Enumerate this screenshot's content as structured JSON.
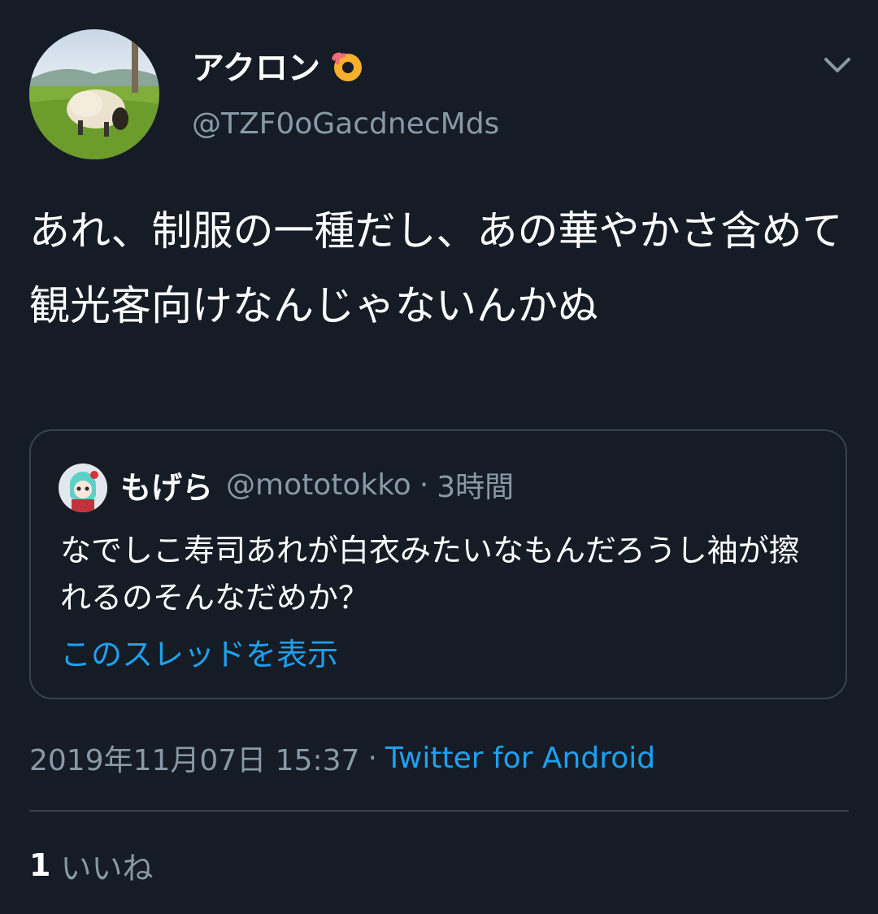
{
  "author": {
    "display_name": "アクロン",
    "emoji_icon": "ok-hand-emoji-icon",
    "handle": "@TZF0oGacdnecMds",
    "avatar_icon": "sheep-photo-avatar"
  },
  "tweet": {
    "text": "あれ、制服の一種だし、あの華やかさ含めて観光客向けなんじゃないんかぬ"
  },
  "quote": {
    "author_name": "もげら",
    "author_handle": "@mototokko",
    "separator": "·",
    "time": "3時間",
    "text": "なでしこ寿司あれが白衣みたいなもんだろうし袖が擦れるのそんなだめか？",
    "link_label": "このスレッドを表示",
    "avatar_icon": "anime-character-avatar"
  },
  "meta": {
    "datetime": "2019年11月07日 15:37",
    "separator": "·",
    "source": "Twitter for Android"
  },
  "likes": {
    "count": "1",
    "label": "いいね"
  },
  "colors": {
    "background": "#151c25",
    "text": "#ffffff",
    "secondary": "#8899a6",
    "accent": "#1da1f2",
    "border": "#38444d"
  },
  "icons": {
    "menu": "chevron-down-icon"
  }
}
